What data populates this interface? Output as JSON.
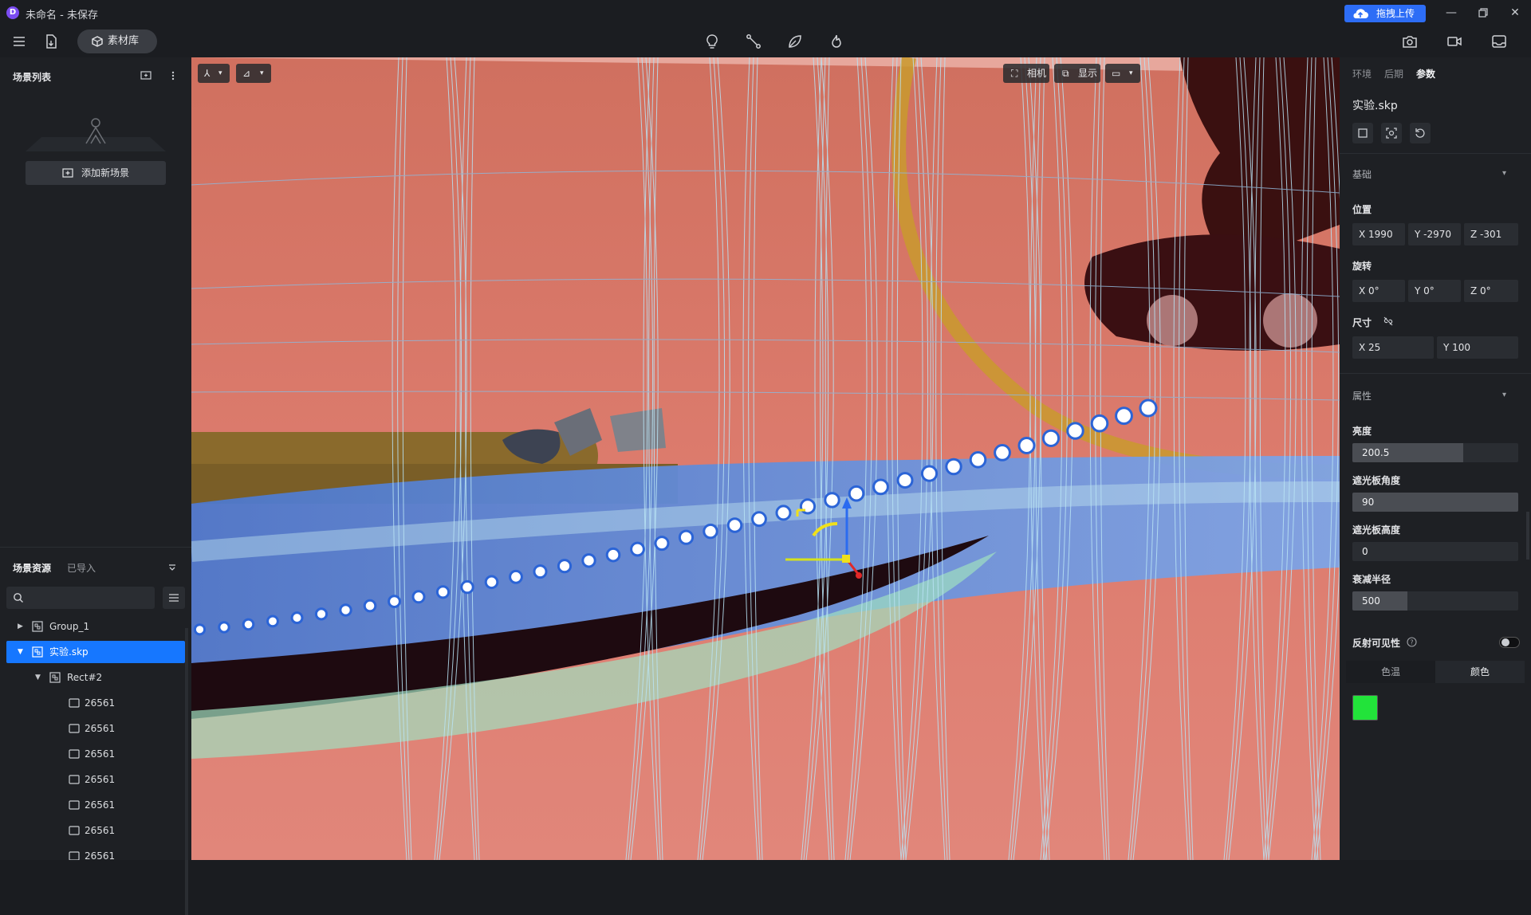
{
  "window": {
    "title": "未命名 - 未保存",
    "logo_letter": "D",
    "upload_label": "拖拽上传",
    "accent": "#1677ff"
  },
  "toolbar": {
    "asset_library_label": "素材库"
  },
  "scene_list": {
    "title": "场景列表",
    "add_scene_label": "添加新场景"
  },
  "assets": {
    "tab_resources": "场景资源",
    "tab_imported": "已导入",
    "search_placeholder": "",
    "tree": [
      {
        "label": "Group_1",
        "expanded": false,
        "selected": false,
        "level": 0,
        "icon": "group-icon"
      },
      {
        "label": "实验.skp",
        "expanded": true,
        "selected": true,
        "level": 0,
        "icon": "group-icon"
      },
      {
        "label": "Rect#2",
        "expanded": true,
        "selected": false,
        "level": 1,
        "icon": "group-icon"
      },
      {
        "label": "26561",
        "level": 2,
        "icon": "mesh-icon"
      },
      {
        "label": "26561",
        "level": 2,
        "icon": "mesh-icon"
      },
      {
        "label": "26561",
        "level": 2,
        "icon": "mesh-icon"
      },
      {
        "label": "26561",
        "level": 2,
        "icon": "mesh-icon"
      },
      {
        "label": "26561",
        "level": 2,
        "icon": "mesh-icon"
      },
      {
        "label": "26561",
        "level": 2,
        "icon": "mesh-icon"
      },
      {
        "label": "26561",
        "level": 2,
        "icon": "mesh-icon"
      }
    ]
  },
  "viewport": {
    "camera_label": "相机",
    "display_label": "显示"
  },
  "inspector": {
    "tabs": [
      "环境",
      "后期",
      "参数"
    ],
    "active_tab": "参数",
    "object_name": "实验.skp",
    "basic_section": "基础",
    "position_label": "位置",
    "position": {
      "x": "X  1990",
      "y": "Y  -2970",
      "z": "Z  -301"
    },
    "rotation_label": "旋转",
    "rotation": {
      "x": "X  0°",
      "y": "Y  0°",
      "z": "Z  0°"
    },
    "size_label": "尺寸",
    "size": {
      "x": "X  25",
      "y": "Y  100"
    },
    "attr_section": "属性",
    "brightness_label": "亮度",
    "brightness": "200.5",
    "brightness_fraction": 0.67,
    "barn_angle_label": "遮光板角度",
    "barn_angle": "90",
    "barn_angle_fraction": 1.0,
    "barn_height_label": "遮光板高度",
    "barn_height": "0",
    "barn_height_fraction": 0.0,
    "falloff_label": "衰减半径",
    "falloff": "500",
    "falloff_fraction": 0.33,
    "reflect_label": "反射可见性",
    "reflect_on": false,
    "color_temp_label": "色温",
    "color_label": "颜色",
    "light_color": "#22e33a"
  }
}
